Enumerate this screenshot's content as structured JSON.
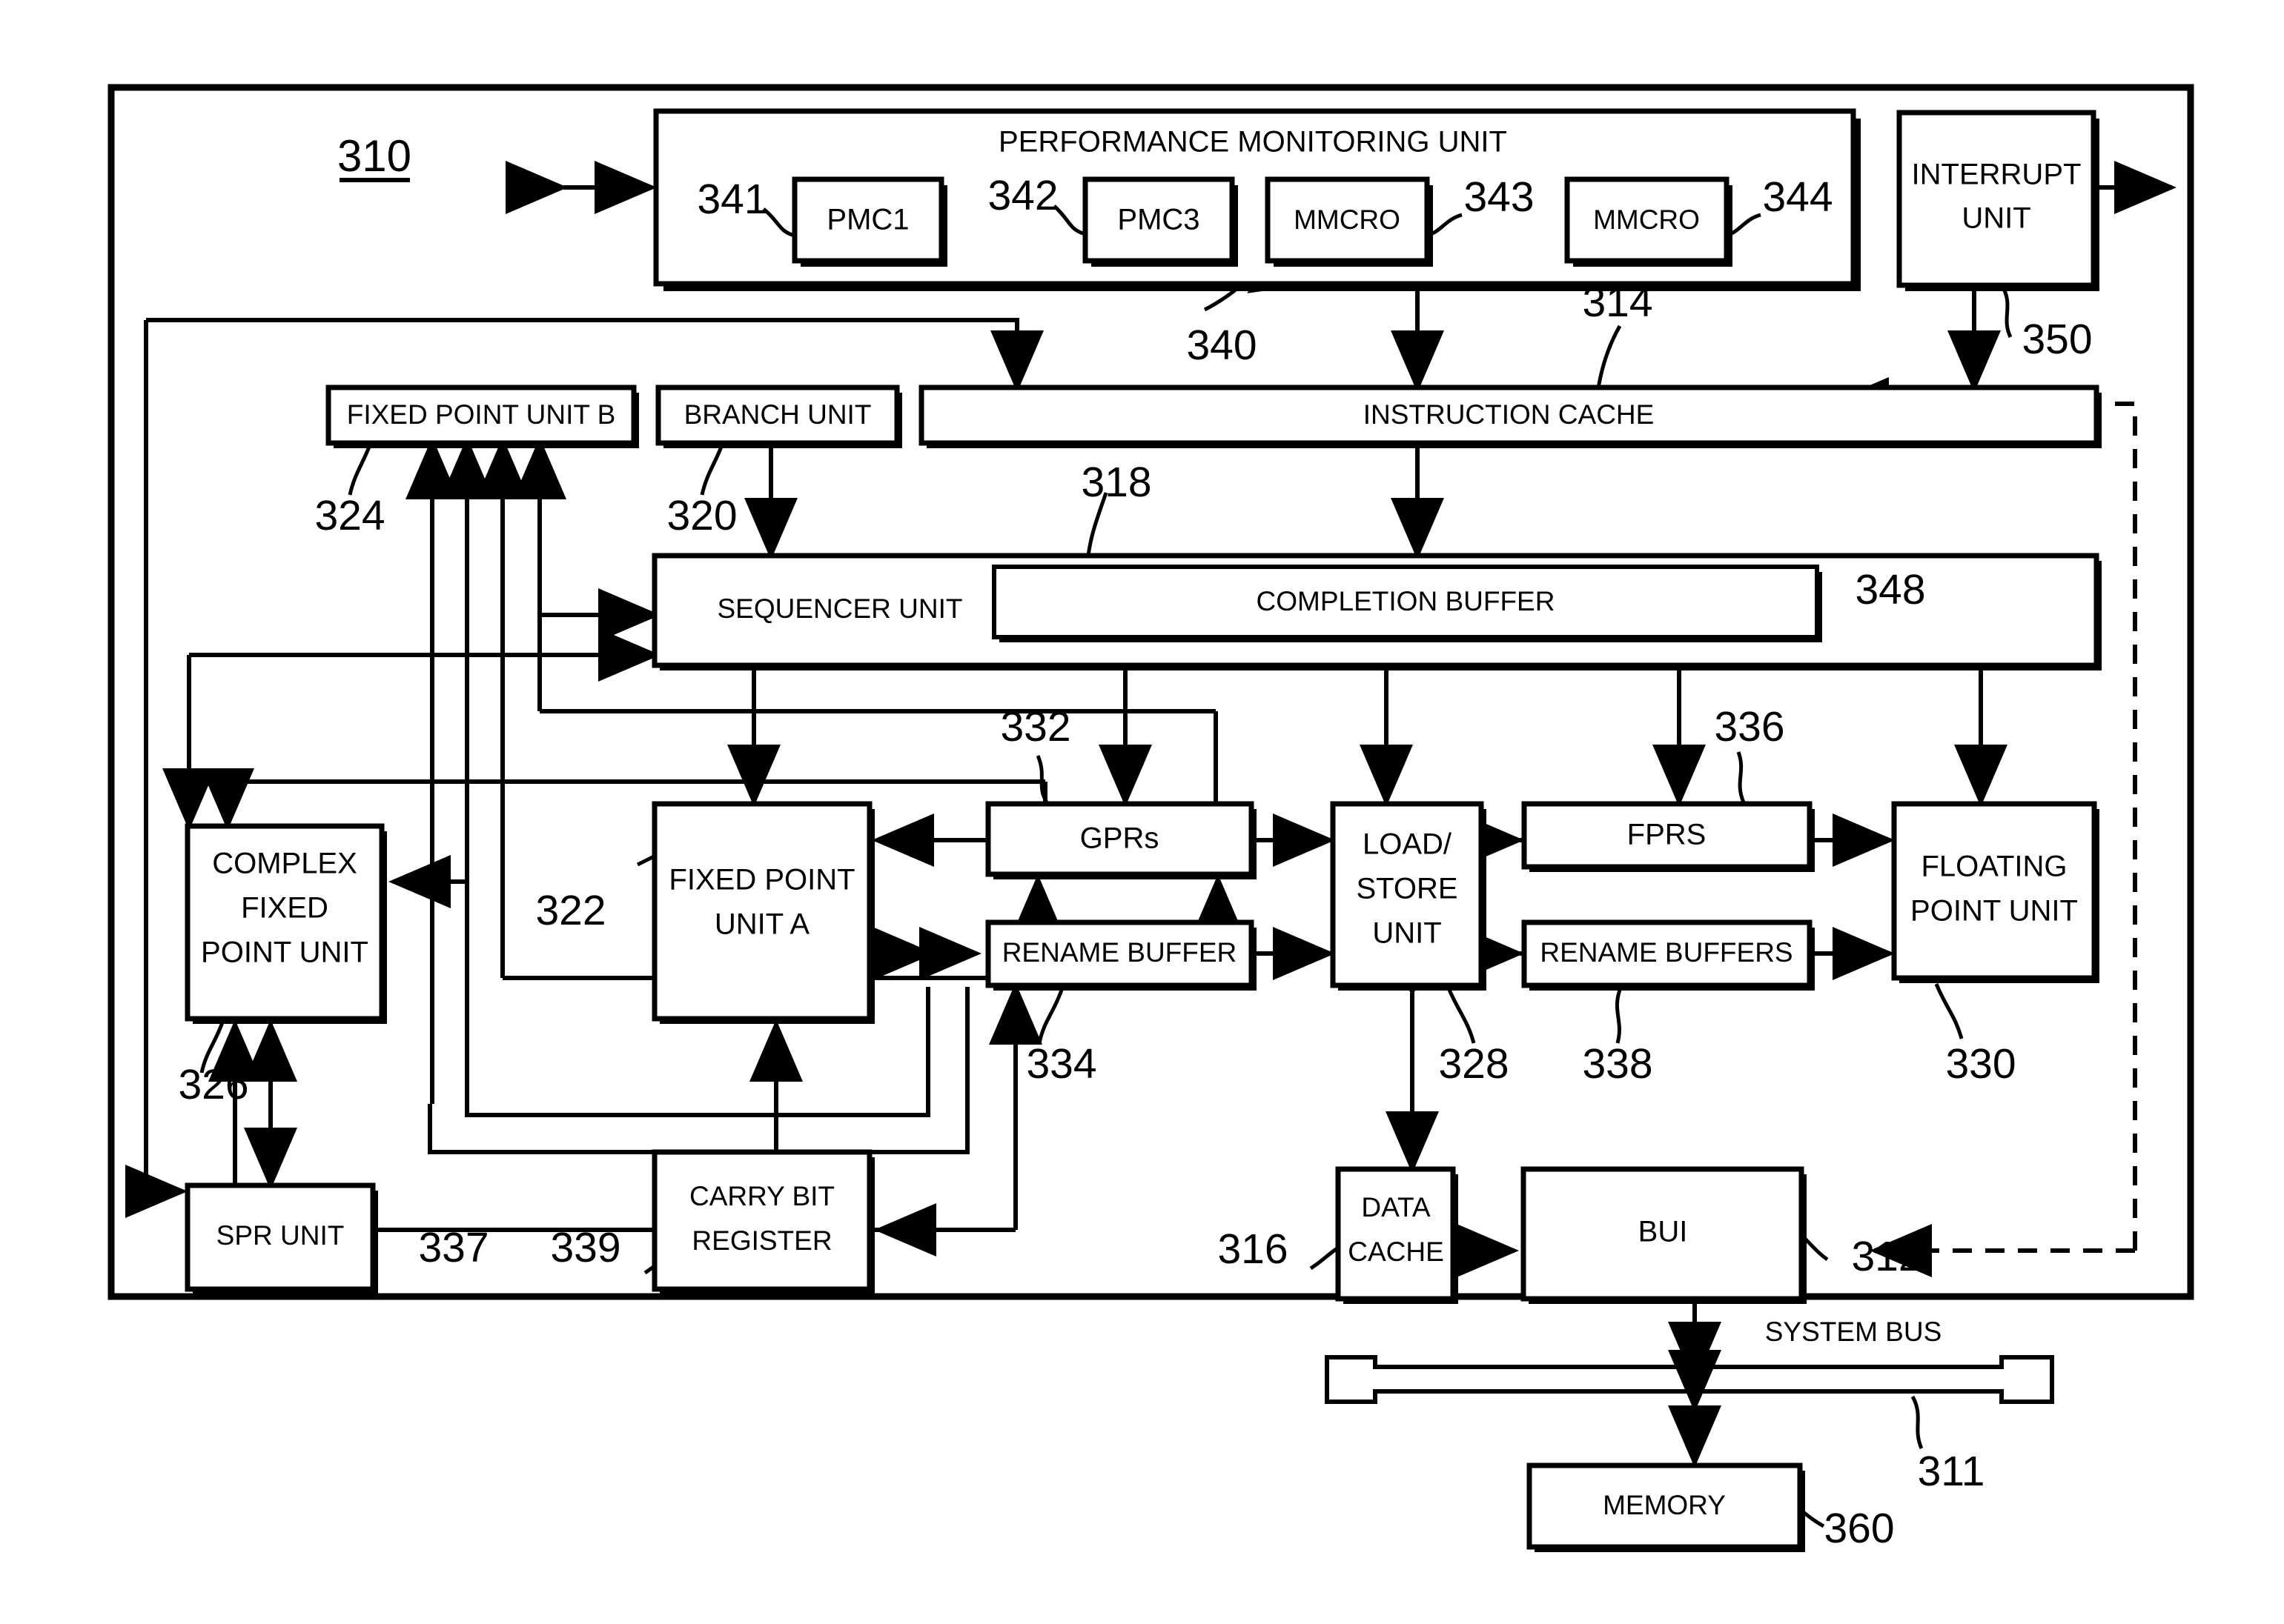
{
  "figure": {
    "reference_310": "310",
    "system_bus_label": "SYSTEM BUS",
    "reference_311": "311",
    "reference_360": "360"
  },
  "blocks": {
    "pmu": {
      "title": "PERFORMANCE MONITORING UNIT",
      "ref": "340"
    },
    "pmc1": {
      "label": "PMC1",
      "ref": "341"
    },
    "pmc3": {
      "label": "PMC3",
      "ref": "342"
    },
    "mmcro_a": {
      "label": "MMCRO",
      "ref": "343"
    },
    "mmcro_b": {
      "label": "MMCRO",
      "ref": "344"
    },
    "interrupt_unit": {
      "line1": "INTERRUPT",
      "line2": "UNIT",
      "ref": "350"
    },
    "fixed_point_unit_b": {
      "label": "FIXED POINT UNIT B",
      "ref": "324"
    },
    "branch_unit": {
      "label": "BRANCH UNIT",
      "ref": "320"
    },
    "instruction_cache": {
      "label": "INSTRUCTION CACHE",
      "ref": "314"
    },
    "sequencer_unit": {
      "label": "SEQUENCER UNIT",
      "ref": "318"
    },
    "completion_buffer": {
      "label": "COMPLETION BUFFER",
      "ref": "348"
    },
    "complex_fixed_point_unit": {
      "line1": "COMPLEX",
      "line2": "FIXED",
      "line3": "POINT UNIT",
      "ref": "326"
    },
    "fixed_point_unit_a": {
      "line1": "FIXED POINT",
      "line2": "UNIT A",
      "ref": "322"
    },
    "gprs": {
      "label": "GPRs",
      "ref": "332"
    },
    "rename_buffer": {
      "label": "RENAME BUFFER",
      "ref": "334"
    },
    "load_store_unit": {
      "line1": "LOAD/",
      "line2": "STORE",
      "line3": "UNIT",
      "ref": "328"
    },
    "fprs": {
      "label": "FPRS",
      "ref": "336"
    },
    "rename_buffers": {
      "label": "RENAME BUFFERS",
      "ref": "338"
    },
    "floating_point_unit": {
      "line1": "FLOATING",
      "line2": "POINT UNIT",
      "ref": "330"
    },
    "spr_unit": {
      "label": "SPR UNIT",
      "ref": "337"
    },
    "carry_bit_register": {
      "line1": "CARRY BIT",
      "line2": "REGISTER",
      "ref": "339"
    },
    "data_cache": {
      "line1": "DATA",
      "line2": "CACHE",
      "ref": "316"
    },
    "bui": {
      "label": "BUI",
      "ref": "312"
    },
    "memory": {
      "label": "MEMORY",
      "ref": "360"
    }
  },
  "colors": {
    "stroke": "#000000",
    "fill": "#ffffff"
  }
}
